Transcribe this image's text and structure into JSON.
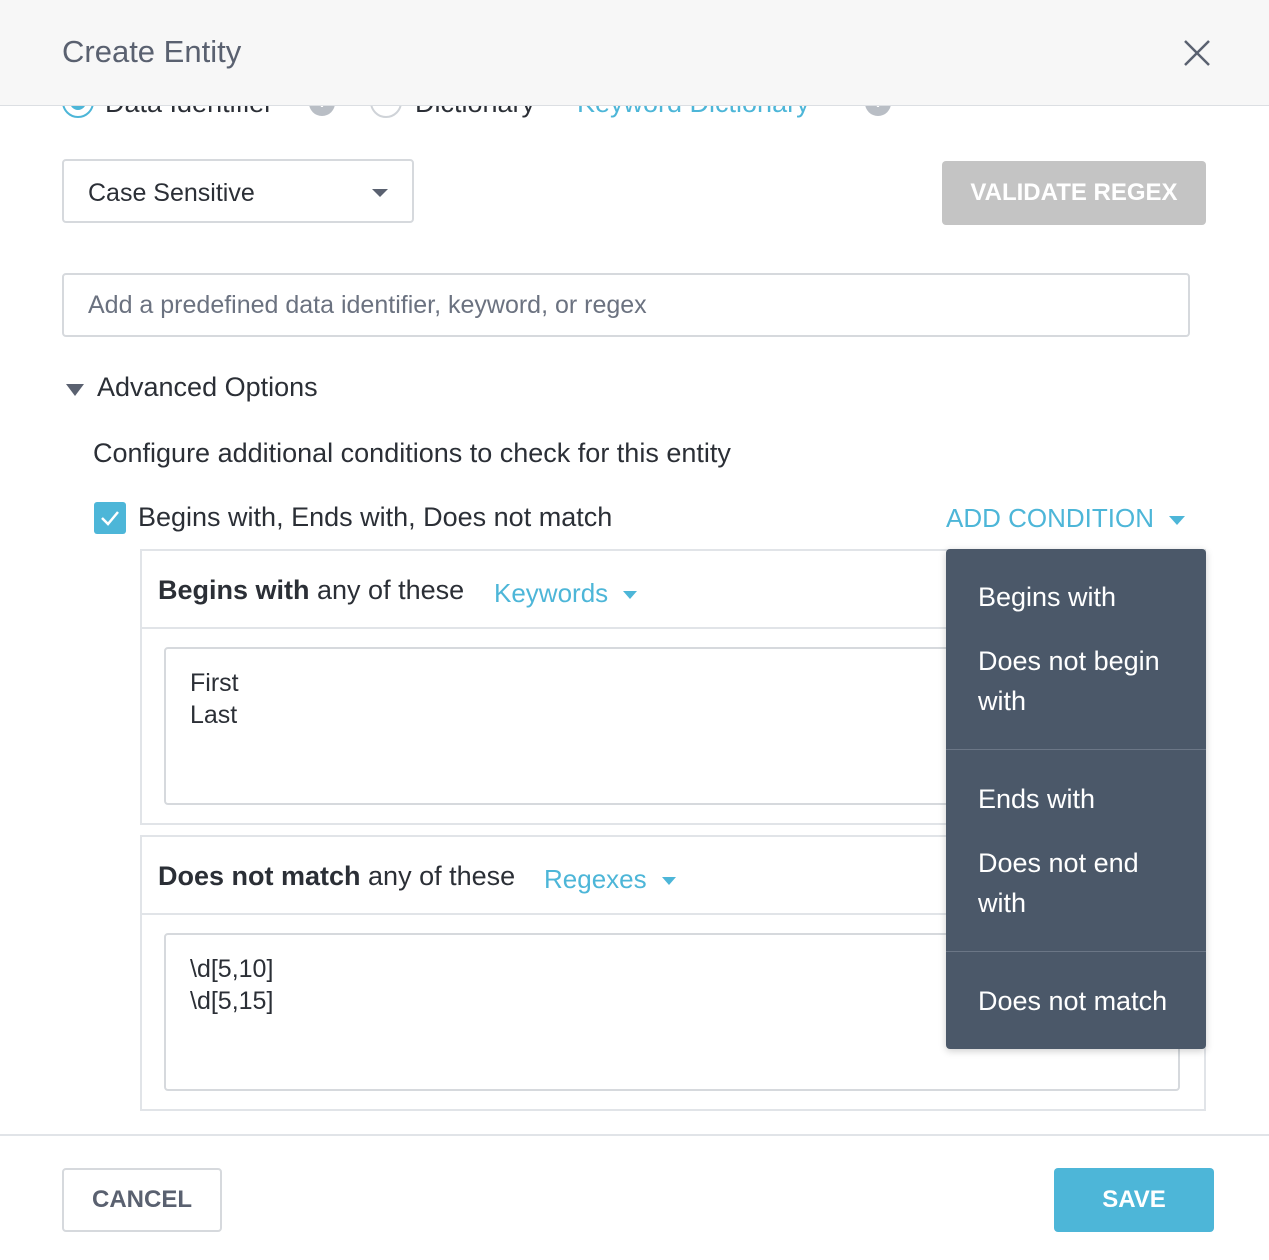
{
  "dialog": {
    "title": "Create Entity"
  },
  "source_options": {
    "option1_label": "Data Identifier",
    "option2_label": "Dictionary",
    "dictionary_link": "Keyword Dictionary",
    "selected": "Data Identifier"
  },
  "case_select": {
    "value": "Case Sensitive"
  },
  "validate_button": {
    "label": "VALIDATE REGEX"
  },
  "entity_input": {
    "placeholder": "Add a predefined data identifier, keyword, or regex",
    "value": ""
  },
  "advanced": {
    "title": "Advanced Options",
    "expanded": true,
    "description": "Configure additional conditions to check for this entity",
    "checkbox_label": "Begins with, Ends with, Does not match",
    "checkbox_checked": true,
    "add_condition_label": "ADD CONDITION"
  },
  "conditions": [
    {
      "title_bold": "Begins with",
      "title_rest": " any of these",
      "type_label": "Keywords",
      "values_text": "First\nLast"
    },
    {
      "title_bold": "Does not match",
      "title_rest": " any of these",
      "type_label": "Regexes",
      "values_text": "\\d[5,10]\n\\d[5,15]"
    }
  ],
  "condition_menu": {
    "items": [
      "Begins with",
      "Does not begin with",
      "Ends with",
      "Does not end with",
      "Does not match"
    ]
  },
  "footer": {
    "cancel_label": "CANCEL",
    "save_label": "SAVE"
  },
  "colors": {
    "accent": "#4db6d8",
    "menu_bg": "#4b5869",
    "disabled_button": "#c4c4c4"
  }
}
